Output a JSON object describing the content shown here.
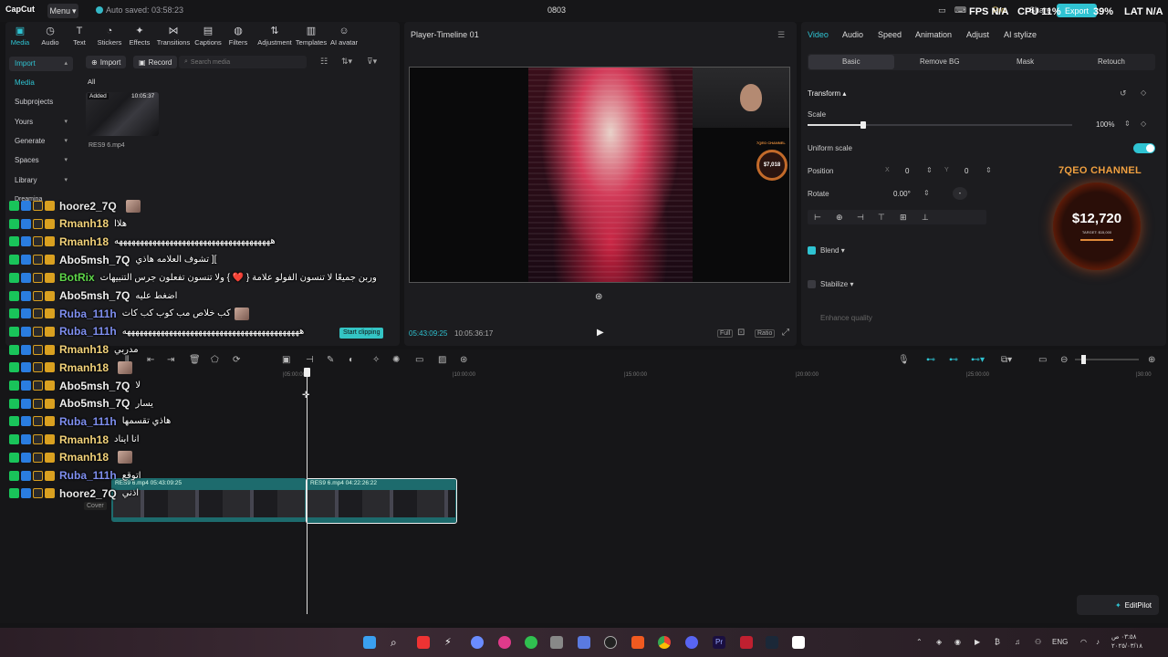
{
  "titlebar": {
    "app_name": "CapCut",
    "menu_label": "Menu",
    "autosave_text": "Auto saved: 03:58:23",
    "project_title": "0803",
    "pro_label": "Pro",
    "share_label": "Share",
    "export_label": "Export"
  },
  "stream_overlay": {
    "fps_text": "FPS N/A",
    "cpu_text": "CPU 11%",
    "gpu_text": "39%",
    "lat_text": "LAT N/A"
  },
  "toolbar": {
    "items": [
      "Media",
      "Audio",
      "Text",
      "Stickers",
      "Effects",
      "Transitions",
      "Captions",
      "Filters",
      "Adjustment",
      "Templates",
      "AI avatar"
    ],
    "active": "Media"
  },
  "sidebar": {
    "items": [
      "Import",
      "Media",
      "Subprojects",
      "Yours",
      "Generate",
      "Spaces",
      "Library",
      "Dreamina"
    ]
  },
  "media_panel": {
    "import_label": "Import",
    "record_label": "Record",
    "search_placeholder": "Search media",
    "filter_all": "All",
    "thumb_badge": "Added",
    "thumb_duration": "10:05:37",
    "thumb_name": "RES9 6.mp4"
  },
  "player": {
    "title": "Player-Timeline 01",
    "time_current": "05:43:09:25",
    "time_total": "10:05:36:17",
    "full_label": "Full",
    "ratio_label": "Ratio",
    "mini_gauge_amount": "$7,018",
    "mini_channel": "7QEO CHANNEL"
  },
  "right_panel": {
    "tabs": [
      "Video",
      "Audio",
      "Speed",
      "Animation",
      "Adjust",
      "AI stylize"
    ],
    "active_tab": "Video",
    "subtabs": [
      "Basic",
      "Remove BG",
      "Mask",
      "Retouch"
    ],
    "active_subtab": "Basic",
    "transform_label": "Transform",
    "scale_label": "Scale",
    "scale_value": "100%",
    "scale_fraction": 0.21,
    "uniform_label": "Uniform scale",
    "uniform_on": true,
    "position_label": "Position",
    "pos_x_label": "X",
    "pos_x": "0",
    "pos_y_label": "Y",
    "pos_y": "0",
    "rotate_label": "Rotate",
    "rotate_value": "0.00°",
    "rotate_dash": "-",
    "blend_label": "Blend",
    "blend_checked": true,
    "stabilize_label": "Stabilize",
    "stabilize_checked": false,
    "enhance_label": "Enhance quality"
  },
  "donation_overlay": {
    "channel_name": "7QEO CHANNEL",
    "amount": "$12,720",
    "target_text": "TARGET: $15,000"
  },
  "timeline": {
    "ruler": [
      "|05:00:00",
      "|10:00:00",
      "|15:00:00",
      "|20:00:00",
      "|25:00:00",
      "|30:00"
    ],
    "clip1_label": "RES9 6.mp4   05:43:09:25",
    "clip2_label": "RES9 6.mp4   04:22:26:22",
    "cover_label": "Cover",
    "editpilot_label": "EditPilot"
  },
  "chat": [
    {
      "user": "hoore2_7Q",
      "color": "#e8e8e8",
      "msg": "",
      "emote": true
    },
    {
      "user": "Rmanh18",
      "color": "#f2d27a",
      "msg": "هلاا",
      "emote": false
    },
    {
      "user": "Rmanh18",
      "color": "#f2d27a",
      "msg": "هههههههههههههههههههههههههههههههههههههه",
      "emote": false
    },
    {
      "user": "Abo5msh_7Q",
      "color": "#f0f0f0",
      "msg": "تشوف العلامه هاذي ][",
      "emote": false
    },
    {
      "user": "BotRix",
      "color": "#5fd84a",
      "msg": "وربن جميعًا لا تنسون الفولو علامة { ❤️ } ولا تنسون تفعلون جرس التنبيهات",
      "emote": false
    },
    {
      "user": "Abo5msh_7Q",
      "color": "#f0f0f0",
      "msg": "اضغط عليه",
      "emote": false
    },
    {
      "user": "Ruba_111h",
      "color": "#7f8ff0",
      "msg": "كب خلاص مب كوب كب كات",
      "emote": true
    },
    {
      "user": "Ruba_111h",
      "color": "#7f8ff0",
      "msg": "ههههههههههههههههههههههههههههههههههههههههههه",
      "emote": false
    },
    {
      "user": "Rmanh18",
      "color": "#f2d27a",
      "msg": "مدربي",
      "emote": false
    },
    {
      "user": "Rmanh18",
      "color": "#f2d27a",
      "msg": "",
      "emote": true
    },
    {
      "user": "Abo5msh_7Q",
      "color": "#f0f0f0",
      "msg": "لا",
      "emote": false
    },
    {
      "user": "Abo5msh_7Q",
      "color": "#f0f0f0",
      "msg": "يسار",
      "emote": false
    },
    {
      "user": "Ruba_111h",
      "color": "#7f8ff0",
      "msg": "هاذي تقسمها",
      "emote": false
    },
    {
      "user": "Rmanh18",
      "color": "#f2d27a",
      "msg": "انا ايناد",
      "emote": false
    },
    {
      "user": "Rmanh18",
      "color": "#f2d27a",
      "msg": "",
      "emote": true
    },
    {
      "user": "Ruba_111h",
      "color": "#7f8ff0",
      "msg": "اتوقع",
      "emote": false
    },
    {
      "user": "hoore2_7Q",
      "color": "#e8e8e8",
      "msg": "اذني",
      "emote": false
    }
  ],
  "overlay_pill": "Start clipping",
  "taskbar": {
    "lang": "ENG",
    "time": "٠٣:٥٨ ص",
    "date": "٢٠٢٥/٠٣/١٨"
  }
}
